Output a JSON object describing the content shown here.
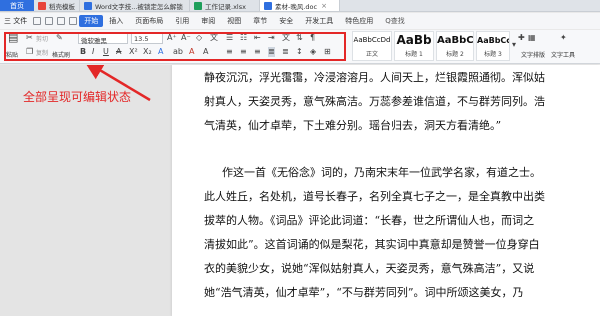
{
  "tabs": {
    "home": "首页",
    "doc1": "稻壳模板",
    "doc2": "Word文字技...被锁定怎么解锁",
    "doc3": "工作记录.xlsx",
    "doc4": "素材-晚风.doc",
    "close_symbol": "×"
  },
  "menu": {
    "file": "三 文件",
    "items": [
      "开始",
      "插入",
      "页面布局",
      "引用",
      "审阅",
      "视图",
      "章节",
      "安全",
      "开发工具",
      "特色应用"
    ],
    "search": "Q查找"
  },
  "ribbon": {
    "paste": "粘贴",
    "cut": "剪切",
    "copy": "复制",
    "format_painter": "格式刷",
    "font_name": "微软雅黑",
    "font_size": "13.5",
    "styles": [
      {
        "sample": "AaBbCcDd",
        "label": "正文"
      },
      {
        "sample": "AaBb",
        "label": "标题 1"
      },
      {
        "sample": "AaBbC",
        "label": "标题 2"
      },
      {
        "sample": "AaBbCc",
        "label": "标题 3"
      }
    ],
    "new_style": "新样式",
    "typeset": "文字排版",
    "find_replace": "查找替换",
    "text_tools": "文字工具"
  },
  "annotation": "全部呈现可编辑状态",
  "document": {
    "lines": [
      "静夜沉沉，浮光霭霭，冷浸溶溶月。人间天上，烂银霞照通彻。浑似姑",
      "射真人，天姿灵秀，意气殊高洁。万蕊参差谁信道，不与群芳同列。浩",
      "气清英，仙才卓荦，下土难分别。瑶台归去，洞天方看清绝。”",
      "",
      "作这一首《无俗念》词的，乃南宋末年一位武学名家，有道之士。",
      "此人姓丘，名处机，道号长春子，名列全真七子之一，是全真教中出类",
      "拔萃的人物。《词品》评论此词道：“长春，世之所谓仙人也，而词之",
      "清拔如此”。这首词诵的似是梨花，其实词中真意却是赞誉一位身穿白",
      "衣的美貌少女，说她“浑似姑射真人，天姿灵秀，意气殊高洁”，又说",
      "她“浩气清英，仙才卓荦”，“不与群芳同列”。词中所颂这美女，乃"
    ]
  },
  "colors": {
    "accent": "#2f6fdf",
    "annotation_red": "#e32727"
  }
}
